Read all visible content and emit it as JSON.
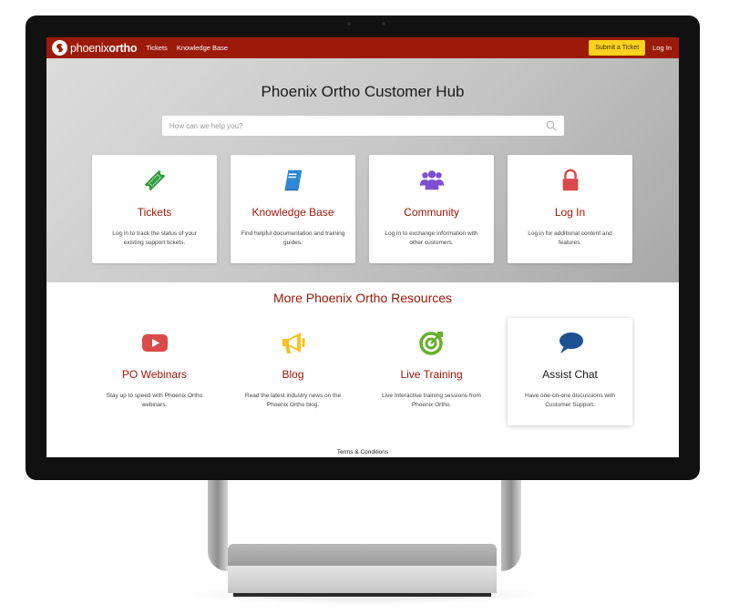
{
  "navbar": {
    "logo_text_light": "phoenix",
    "logo_text_bold": "ortho",
    "links": [
      "Tickets",
      "Knowledge Base"
    ],
    "submit_ticket_label": "Submit a Ticket",
    "login_label": "Log In",
    "brand_color": "#9b1a0a",
    "button_color": "#ffd21f"
  },
  "hero": {
    "title": "Phoenix Ortho Customer Hub",
    "search_placeholder": "How can we help you?",
    "search_value": "",
    "cards": [
      {
        "icon": "ticket-icon",
        "title": "Tickets",
        "description": "Log in to track the status of your existing support tickets.",
        "icon_color": "#2e9e3a"
      },
      {
        "icon": "book-icon",
        "title": "Knowledge Base",
        "description": "Find helpful documentation and training guides.",
        "icon_color": "#2e86d6"
      },
      {
        "icon": "users-icon",
        "title": "Community",
        "description": "Log in to exchange information with other customers.",
        "icon_color": "#7e4fd0"
      },
      {
        "icon": "lock-icon",
        "title": "Log In",
        "description": "Log in for additional content and features.",
        "icon_color": "#d94a4a"
      }
    ]
  },
  "resources": {
    "title": "More Phoenix Ortho Resources",
    "items": [
      {
        "icon": "youtube-icon",
        "title": "PO Webinars",
        "description": "Stay up to speed with Phoenix Ortho webinars.",
        "icon_color": "#d94a4a"
      },
      {
        "icon": "megaphone-icon",
        "title": "Blog",
        "description": "Read the latest industry news on the Phoenix Ortho blog.",
        "icon_color": "#f7c21e"
      },
      {
        "icon": "target-icon",
        "title": "Live Training",
        "description": "Live Interactive training sessions from Phoenix Ortho.",
        "icon_color": "#66b12a"
      },
      {
        "icon": "chat-bubble-icon",
        "title": "Assist Chat",
        "description": "Have one-on-one discussions with Customer Support.",
        "icon_color": "#1d4f93"
      }
    ]
  },
  "footer": {
    "terms_label": "Terms & Conditions"
  }
}
